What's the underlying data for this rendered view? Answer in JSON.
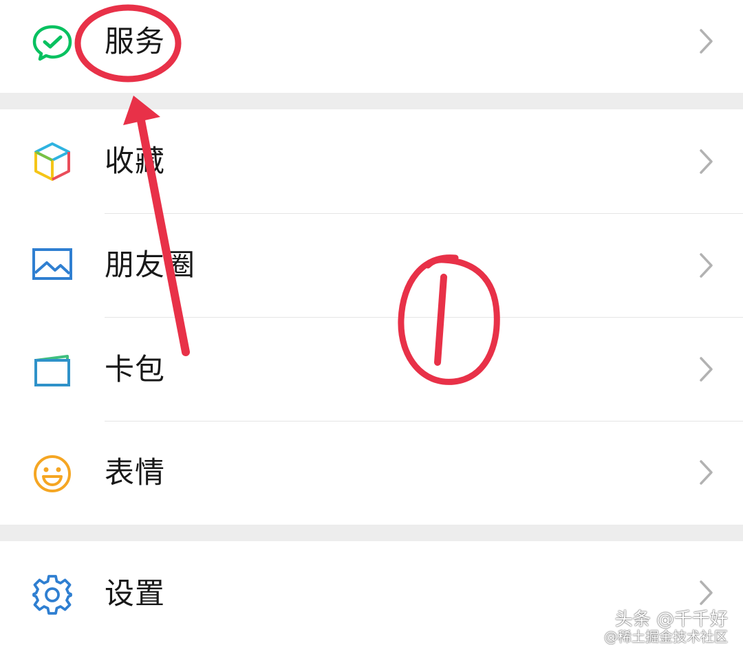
{
  "menu": {
    "items": [
      {
        "label": "服务",
        "icon": "wechat-pay-icon",
        "color": "#07c160"
      },
      {
        "label": "收藏",
        "icon": "cube-icon",
        "color": "#f0b429"
      },
      {
        "label": "朋友圈",
        "icon": "picture-icon",
        "color": "#2f7fd1"
      },
      {
        "label": "卡包",
        "icon": "card-wallet-icon",
        "color": "#2f92c9"
      },
      {
        "label": "表情",
        "icon": "smiley-icon",
        "color": "#f5a623"
      },
      {
        "label": "设置",
        "icon": "gear-icon",
        "color": "#2f7fd1"
      }
    ]
  },
  "annotation": {
    "circle_number": "1",
    "stroke_color": "#e83148"
  },
  "watermark": {
    "line1": "头条 @千千好",
    "line2": "@稀土掘金技术社区"
  }
}
